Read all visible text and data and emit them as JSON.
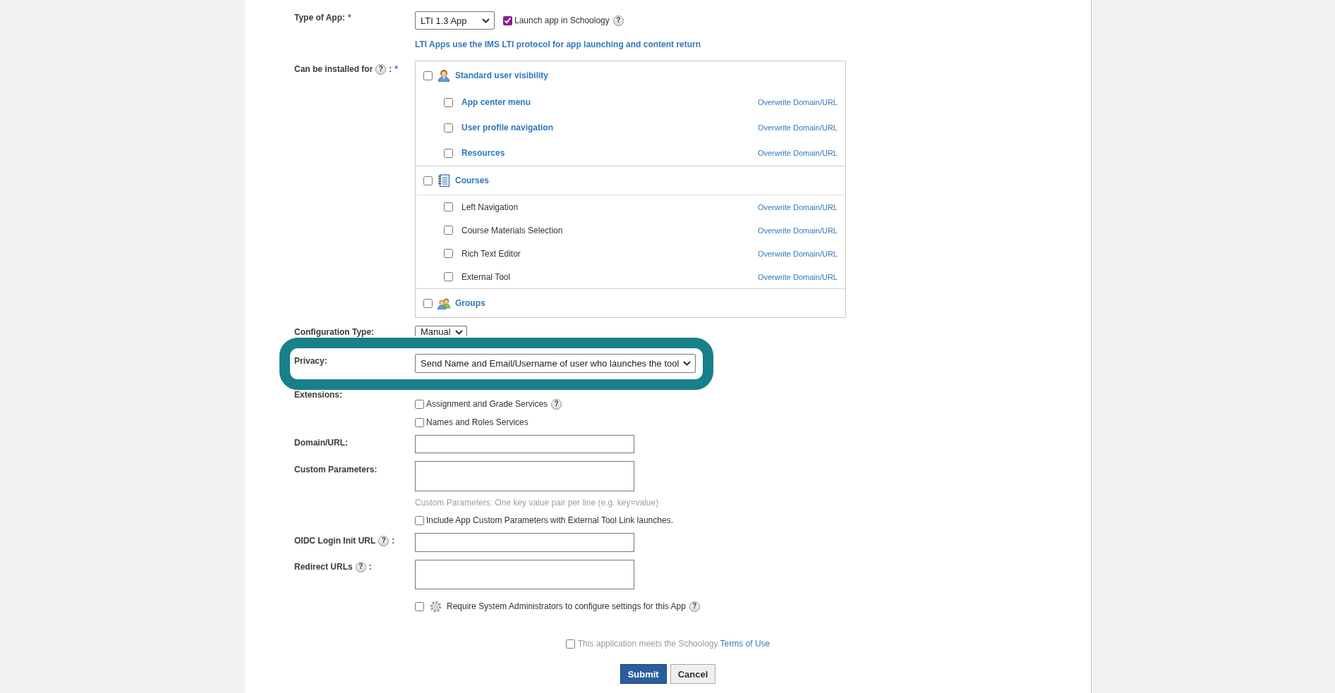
{
  "form": {
    "type_of_app": {
      "label": "Type of App:",
      "required_mark": "*",
      "select_value": "LTI 1.3 App",
      "launch_in_schoology": {
        "label": "Launch app in Schoology",
        "checked": true,
        "help": "?"
      },
      "info_link": "LTI Apps use the IMS LTI protocol for app launching and content return"
    },
    "installed_for": {
      "label": "Can be installed for",
      "help": "?",
      "suffix": ":",
      "required_mark": "*",
      "groups": [
        {
          "kind": "user",
          "label": "Standard user visibility",
          "checked": false,
          "children": [
            {
              "kind": "link",
              "label": "App center menu",
              "checked": false,
              "action": "Overwrite Domain/URL"
            },
            {
              "kind": "link",
              "label": "User profile navigation",
              "checked": false,
              "action": "Overwrite Domain/URL"
            },
            {
              "kind": "link",
              "label": "Resources",
              "checked": false,
              "action": "Overwrite Domain/URL"
            }
          ]
        },
        {
          "kind": "courses",
          "label": "Courses",
          "checked": false,
          "children": [
            {
              "kind": "text",
              "label": "Left Navigation",
              "checked": false,
              "action": "Overwrite Domain/URL"
            },
            {
              "kind": "text",
              "label": "Course Materials Selection",
              "checked": false,
              "action": "Overwrite Domain/URL"
            },
            {
              "kind": "text",
              "label": "Rich Text Editor",
              "checked": false,
              "action": "Overwrite Domain/URL"
            },
            {
              "kind": "text",
              "label": "External Tool",
              "checked": false,
              "action": "Overwrite Domain/URL"
            }
          ]
        },
        {
          "kind": "groups",
          "label": "Groups",
          "checked": false
        }
      ]
    },
    "configuration_type": {
      "label": "Configuration Type:",
      "value": "Manual"
    },
    "privacy": {
      "label": "Privacy:",
      "value": "Send Name and Email/Username of user who launches the tool",
      "highlighted": true
    },
    "extensions": {
      "label": "Extensions:",
      "options": [
        {
          "label": "Assignment and Grade Services",
          "checked": false,
          "help": "?"
        },
        {
          "label": "Names and Roles Services",
          "checked": false
        }
      ]
    },
    "domain_url": {
      "label": "Domain/URL:"
    },
    "custom_parameters": {
      "label": "Custom Parameters:",
      "hint": "Custom Parameters: One key value pair per line (e.g. key=value)",
      "include_option": {
        "label": "Include App Custom Parameters with External Tool Link launches.",
        "checked": false
      }
    },
    "oidc_login_init_url": {
      "label": "OIDC Login Init URL",
      "help": "?",
      "suffix": ":"
    },
    "redirect_urls": {
      "label": "Redirect URLs",
      "help": "?",
      "suffix": ":"
    },
    "require_admins": {
      "label": "Require System Administrators to configure settings for this App",
      "checked": false,
      "help": "?"
    },
    "terms": {
      "text": "This application meets the Schoology",
      "link": "Terms of Use",
      "checked": false
    },
    "buttons": [
      {
        "kind": "primary",
        "label": "Submit"
      },
      {
        "kind": "secondary",
        "label": "Cancel"
      }
    ]
  }
}
